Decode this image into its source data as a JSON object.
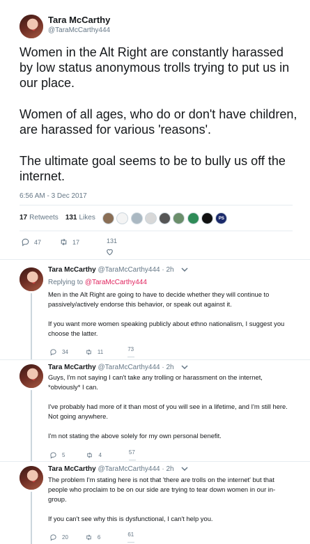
{
  "main": {
    "name": "Tara McCarthy",
    "handle": "@TaraMcCarthy444",
    "paragraphs": [
      "Women in the Alt Right are constantly harassed by low status anonymous trolls trying to put us in our place.",
      "Women of all ages, who do or don't have children, are harassed for various 'reasons'.",
      "The ultimate goal seems to be to bully us off the internet."
    ],
    "timestamp": "6:56 AM - 3 Dec 2017",
    "retweets_count": "17",
    "retweets_label": "Retweets",
    "likes_count": "131",
    "likes_label": "Likes",
    "liker_badge": "PS",
    "reply_count": "47",
    "retweet_count": "17",
    "like_count": "131"
  },
  "replies": [
    {
      "name": "Tara McCarthy",
      "handle": "@TaraMcCarthy444",
      "time": "· 2h",
      "replying_prefix": "Replying to",
      "replying_to": "@TaraMcCarthy444",
      "paragraphs": [
        "Men in the Alt Right are going to have to decide whether they will continue to passively/actively endorse this behavior, or speak out against it.",
        "If you want more women speaking publicly about ethno nationalism, I suggest you choose the latter."
      ],
      "reply_count": "34",
      "retweet_count": "11",
      "like_count": "73"
    },
    {
      "name": "Tara McCarthy",
      "handle": "@TaraMcCarthy444",
      "time": "· 2h",
      "paragraphs": [
        "Guys, I'm not saying I can't take any trolling or harassment on the internet, *obviously* I can.",
        "I've probably had more of it than most of you will see in a lifetime, and I'm still here. Not going anywhere.",
        "I'm not stating the above solely for my own personal benefit."
      ],
      "reply_count": "5",
      "retweet_count": "4",
      "like_count": "57"
    },
    {
      "name": "Tara McCarthy",
      "handle": "@TaraMcCarthy444",
      "time": "· 2h",
      "paragraphs": [
        "The problem I'm stating here is not that 'there are trolls on the internet' but that people who proclaim to be on our side are trying to tear down women in our in-group.",
        "If you can't see why this is dysfunctional, I can't help you."
      ],
      "reply_count": "20",
      "retweet_count": "6",
      "like_count": "61"
    }
  ],
  "colors": {
    "secondary_text": "#657786",
    "link_pink": "#e0245e",
    "divider": "#e6ecf0"
  },
  "icons": [
    "reply-icon",
    "retweet-icon",
    "like-icon",
    "chevron-down-icon"
  ]
}
